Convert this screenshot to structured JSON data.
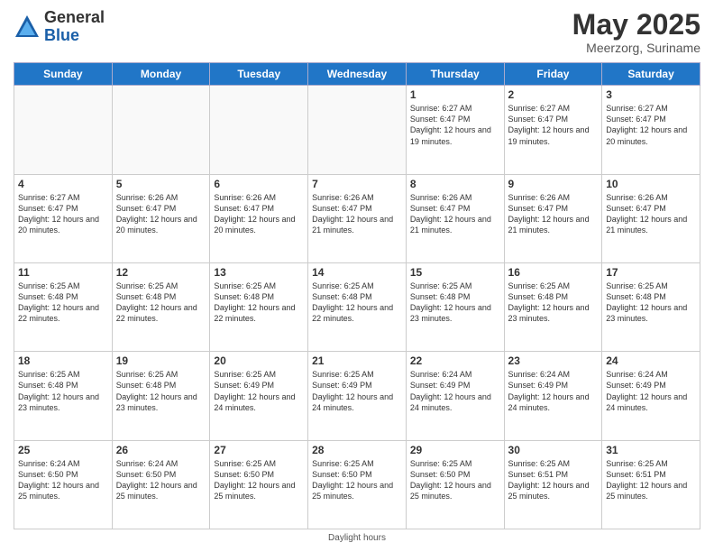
{
  "header": {
    "logo_general": "General",
    "logo_blue": "Blue",
    "month_title": "May 2025",
    "location": "Meerzorg, Suriname"
  },
  "footer": {
    "text": "Daylight hours"
  },
  "days_of_week": [
    "Sunday",
    "Monday",
    "Tuesday",
    "Wednesday",
    "Thursday",
    "Friday",
    "Saturday"
  ],
  "weeks": [
    [
      {
        "day": "",
        "info": ""
      },
      {
        "day": "",
        "info": ""
      },
      {
        "day": "",
        "info": ""
      },
      {
        "day": "",
        "info": ""
      },
      {
        "day": "1",
        "info": "Sunrise: 6:27 AM\nSunset: 6:47 PM\nDaylight: 12 hours\nand 19 minutes."
      },
      {
        "day": "2",
        "info": "Sunrise: 6:27 AM\nSunset: 6:47 PM\nDaylight: 12 hours\nand 19 minutes."
      },
      {
        "day": "3",
        "info": "Sunrise: 6:27 AM\nSunset: 6:47 PM\nDaylight: 12 hours\nand 20 minutes."
      }
    ],
    [
      {
        "day": "4",
        "info": "Sunrise: 6:27 AM\nSunset: 6:47 PM\nDaylight: 12 hours\nand 20 minutes."
      },
      {
        "day": "5",
        "info": "Sunrise: 6:26 AM\nSunset: 6:47 PM\nDaylight: 12 hours\nand 20 minutes."
      },
      {
        "day": "6",
        "info": "Sunrise: 6:26 AM\nSunset: 6:47 PM\nDaylight: 12 hours\nand 20 minutes."
      },
      {
        "day": "7",
        "info": "Sunrise: 6:26 AM\nSunset: 6:47 PM\nDaylight: 12 hours\nand 21 minutes."
      },
      {
        "day": "8",
        "info": "Sunrise: 6:26 AM\nSunset: 6:47 PM\nDaylight: 12 hours\nand 21 minutes."
      },
      {
        "day": "9",
        "info": "Sunrise: 6:26 AM\nSunset: 6:47 PM\nDaylight: 12 hours\nand 21 minutes."
      },
      {
        "day": "10",
        "info": "Sunrise: 6:26 AM\nSunset: 6:47 PM\nDaylight: 12 hours\nand 21 minutes."
      }
    ],
    [
      {
        "day": "11",
        "info": "Sunrise: 6:25 AM\nSunset: 6:48 PM\nDaylight: 12 hours\nand 22 minutes."
      },
      {
        "day": "12",
        "info": "Sunrise: 6:25 AM\nSunset: 6:48 PM\nDaylight: 12 hours\nand 22 minutes."
      },
      {
        "day": "13",
        "info": "Sunrise: 6:25 AM\nSunset: 6:48 PM\nDaylight: 12 hours\nand 22 minutes."
      },
      {
        "day": "14",
        "info": "Sunrise: 6:25 AM\nSunset: 6:48 PM\nDaylight: 12 hours\nand 22 minutes."
      },
      {
        "day": "15",
        "info": "Sunrise: 6:25 AM\nSunset: 6:48 PM\nDaylight: 12 hours\nand 23 minutes."
      },
      {
        "day": "16",
        "info": "Sunrise: 6:25 AM\nSunset: 6:48 PM\nDaylight: 12 hours\nand 23 minutes."
      },
      {
        "day": "17",
        "info": "Sunrise: 6:25 AM\nSunset: 6:48 PM\nDaylight: 12 hours\nand 23 minutes."
      }
    ],
    [
      {
        "day": "18",
        "info": "Sunrise: 6:25 AM\nSunset: 6:48 PM\nDaylight: 12 hours\nand 23 minutes."
      },
      {
        "day": "19",
        "info": "Sunrise: 6:25 AM\nSunset: 6:48 PM\nDaylight: 12 hours\nand 23 minutes."
      },
      {
        "day": "20",
        "info": "Sunrise: 6:25 AM\nSunset: 6:49 PM\nDaylight: 12 hours\nand 24 minutes."
      },
      {
        "day": "21",
        "info": "Sunrise: 6:25 AM\nSunset: 6:49 PM\nDaylight: 12 hours\nand 24 minutes."
      },
      {
        "day": "22",
        "info": "Sunrise: 6:24 AM\nSunset: 6:49 PM\nDaylight: 12 hours\nand 24 minutes."
      },
      {
        "day": "23",
        "info": "Sunrise: 6:24 AM\nSunset: 6:49 PM\nDaylight: 12 hours\nand 24 minutes."
      },
      {
        "day": "24",
        "info": "Sunrise: 6:24 AM\nSunset: 6:49 PM\nDaylight: 12 hours\nand 24 minutes."
      }
    ],
    [
      {
        "day": "25",
        "info": "Sunrise: 6:24 AM\nSunset: 6:50 PM\nDaylight: 12 hours\nand 25 minutes."
      },
      {
        "day": "26",
        "info": "Sunrise: 6:24 AM\nSunset: 6:50 PM\nDaylight: 12 hours\nand 25 minutes."
      },
      {
        "day": "27",
        "info": "Sunrise: 6:25 AM\nSunset: 6:50 PM\nDaylight: 12 hours\nand 25 minutes."
      },
      {
        "day": "28",
        "info": "Sunrise: 6:25 AM\nSunset: 6:50 PM\nDaylight: 12 hours\nand 25 minutes."
      },
      {
        "day": "29",
        "info": "Sunrise: 6:25 AM\nSunset: 6:50 PM\nDaylight: 12 hours\nand 25 minutes."
      },
      {
        "day": "30",
        "info": "Sunrise: 6:25 AM\nSunset: 6:51 PM\nDaylight: 12 hours\nand 25 minutes."
      },
      {
        "day": "31",
        "info": "Sunrise: 6:25 AM\nSunset: 6:51 PM\nDaylight: 12 hours\nand 25 minutes."
      }
    ]
  ]
}
